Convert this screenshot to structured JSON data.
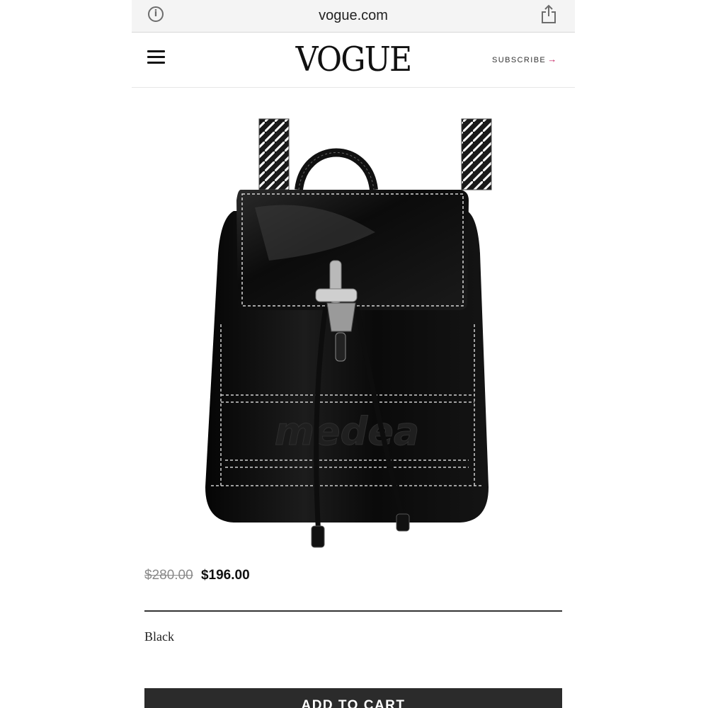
{
  "browser": {
    "url": "vogue.com",
    "info_icon": "info-icon",
    "share_icon": "share-icon"
  },
  "header": {
    "menu_icon": "hamburger-menu-icon",
    "logo": "VOGUE",
    "subscribe_label": "SUBSCRIBE",
    "subscribe_arrow": "→",
    "accent_color": "#c2185b"
  },
  "product": {
    "image_description_icon": "backpack-image",
    "embossed_text": "medea",
    "original_price": "$280.00",
    "sale_price": "$196.00",
    "color": "Black",
    "cart_button_label": "ADD TO CART"
  }
}
